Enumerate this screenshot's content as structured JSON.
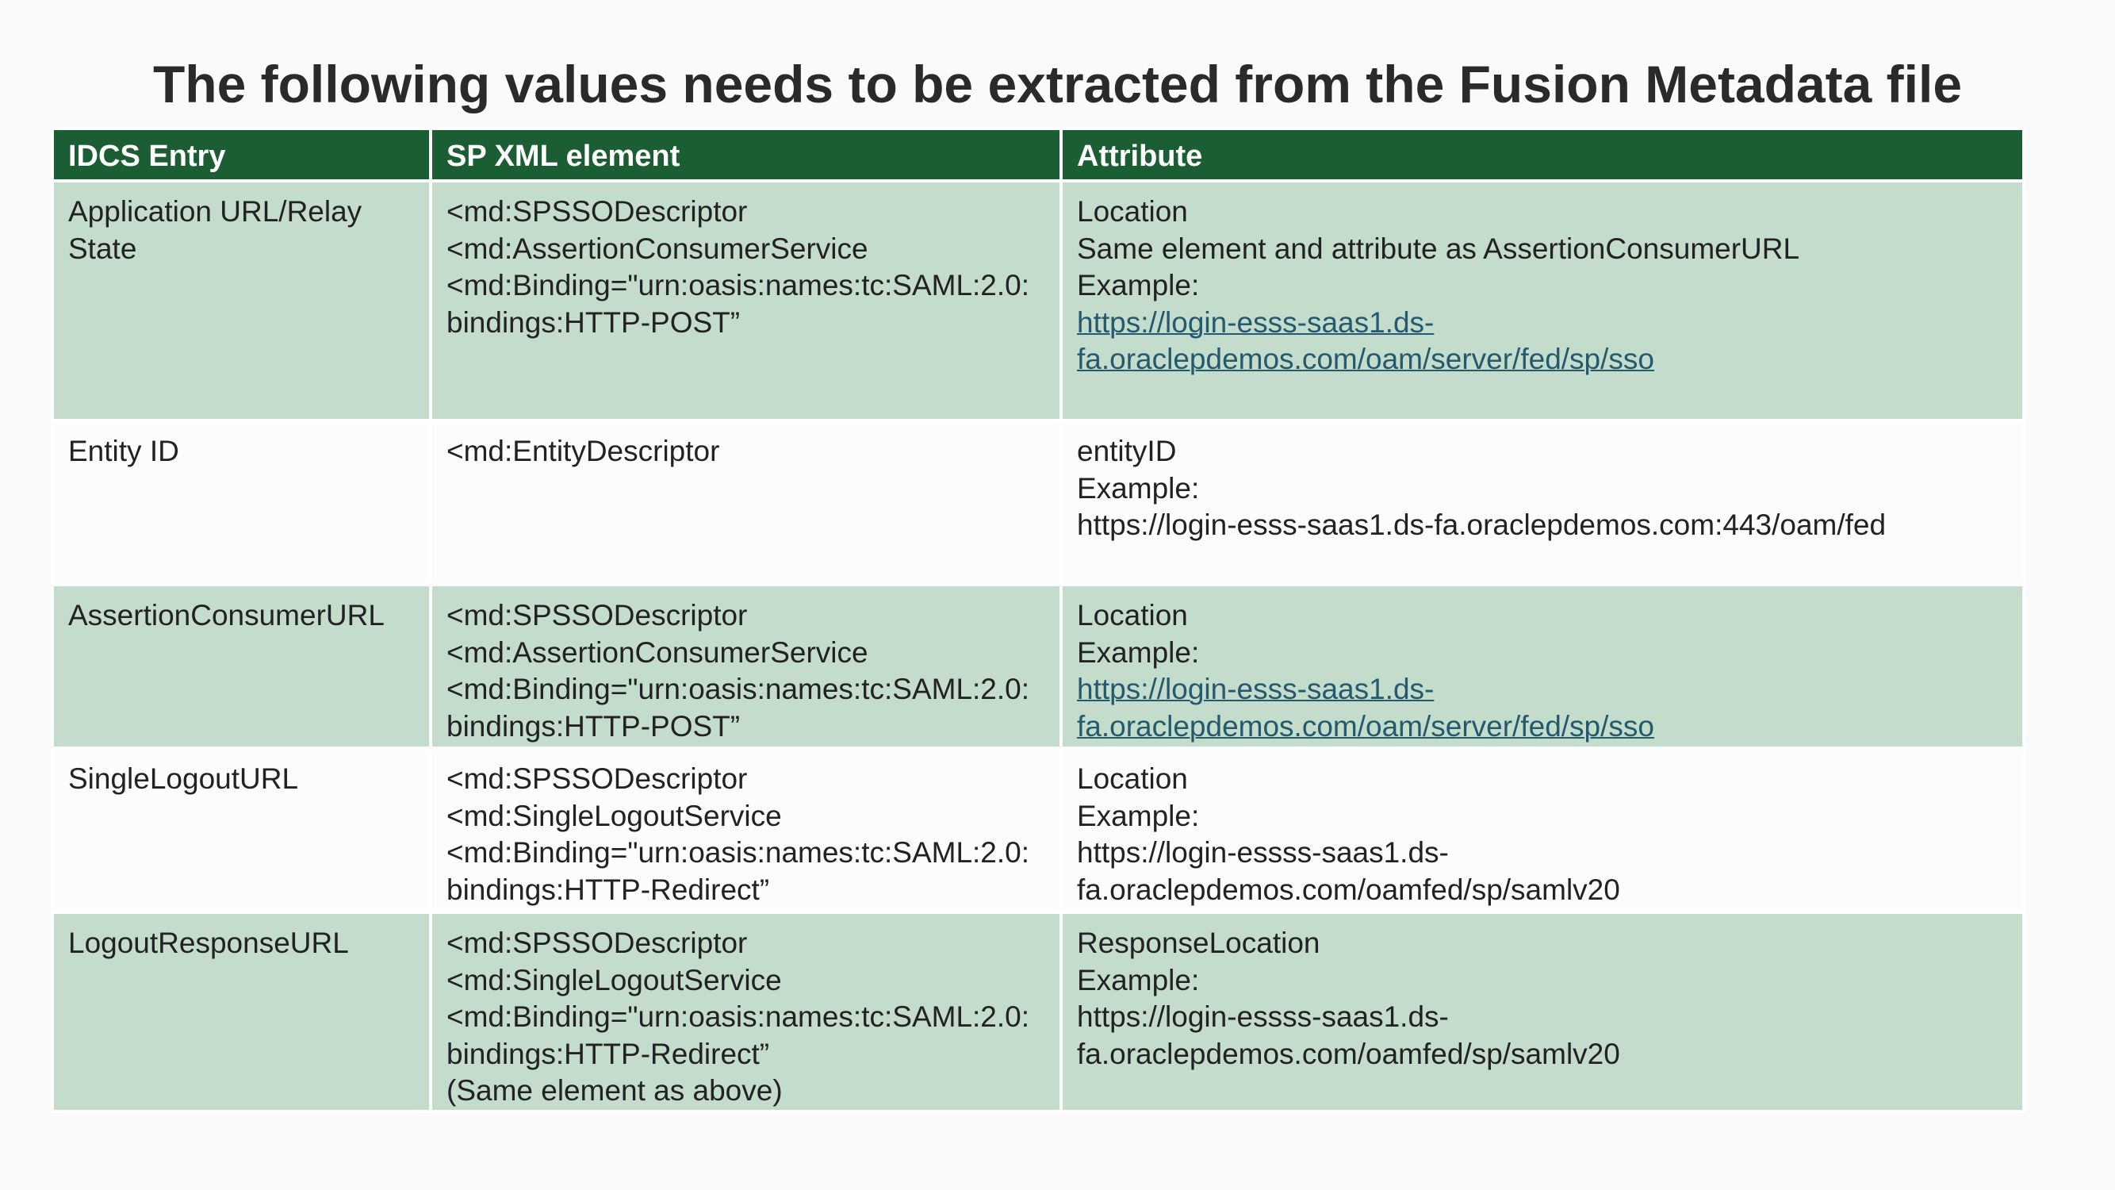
{
  "title": "The following values needs to be extracted from the Fusion Metadata file",
  "columns": [
    "IDCS Entry",
    "SP XML element",
    "Attribute"
  ],
  "rows": [
    {
      "entry": "Application URL/Relay State",
      "sp_lines": [
        "<md:SPSSODescriptor",
        "<md:AssertionConsumerService",
        "<md:Binding=\"urn:oasis:names:tc:SAML:2.0:bindings:HTTP-POST”"
      ],
      "attr_lines": [
        "Location",
        "Same element and attribute as AssertionConsumerURL",
        "Example:"
      ],
      "attr_link": "https://login-esss-saas1.ds-fa.oraclepdemos.com/oam/server/fed/sp/sso"
    },
    {
      "entry": "Entity ID",
      "sp_lines": [
        "<md:EntityDescriptor"
      ],
      "attr_lines": [
        "entityID",
        "Example:",
        "https://login-esss-saas1.ds-fa.oraclepdemos.com:443/oam/fed"
      ]
    },
    {
      "entry": "AssertionConsumerURL",
      "sp_lines": [
        "<md:SPSSODescriptor",
        "<md:AssertionConsumerService",
        "<md:Binding=\"urn:oasis:names:tc:SAML:2.0:bindings:HTTP-POST”"
      ],
      "attr_lines": [
        "Location",
        "Example:"
      ],
      "attr_link": "https://login-esss-saas1.ds-fa.oraclepdemos.com/oam/server/fed/sp/sso"
    },
    {
      "entry": "SingleLogoutURL",
      "sp_lines": [
        "<md:SPSSODescriptor",
        "<md:SingleLogoutService",
        "<md:Binding=\"urn:oasis:names:tc:SAML:2.0:bindings:HTTP-Redirect”"
      ],
      "attr_lines": [
        "Location",
        "Example:",
        "https://login-essss-saas1.ds-fa.oraclepdemos.com/oamfed/sp/samlv20"
      ]
    },
    {
      "entry": "LogoutResponseURL",
      "sp_lines": [
        "<md:SPSSODescriptor",
        "<md:SingleLogoutService",
        "<md:Binding=\"urn:oasis:names:tc:SAML:2.0:bindings:HTTP-Redirect”",
        "(Same element as above)"
      ],
      "attr_lines": [
        "ResponseLocation",
        "Example:",
        "https://login-essss-saas1.ds-fa.oraclepdemos.com/oamfed/sp/samlv20"
      ]
    }
  ],
  "colors": {
    "header_bg": "#1c5e33",
    "header_text": "#ffffff",
    "row_shaded": "#c4dccb",
    "row_plain": "#fcfcfc",
    "link": "#255a6e"
  }
}
